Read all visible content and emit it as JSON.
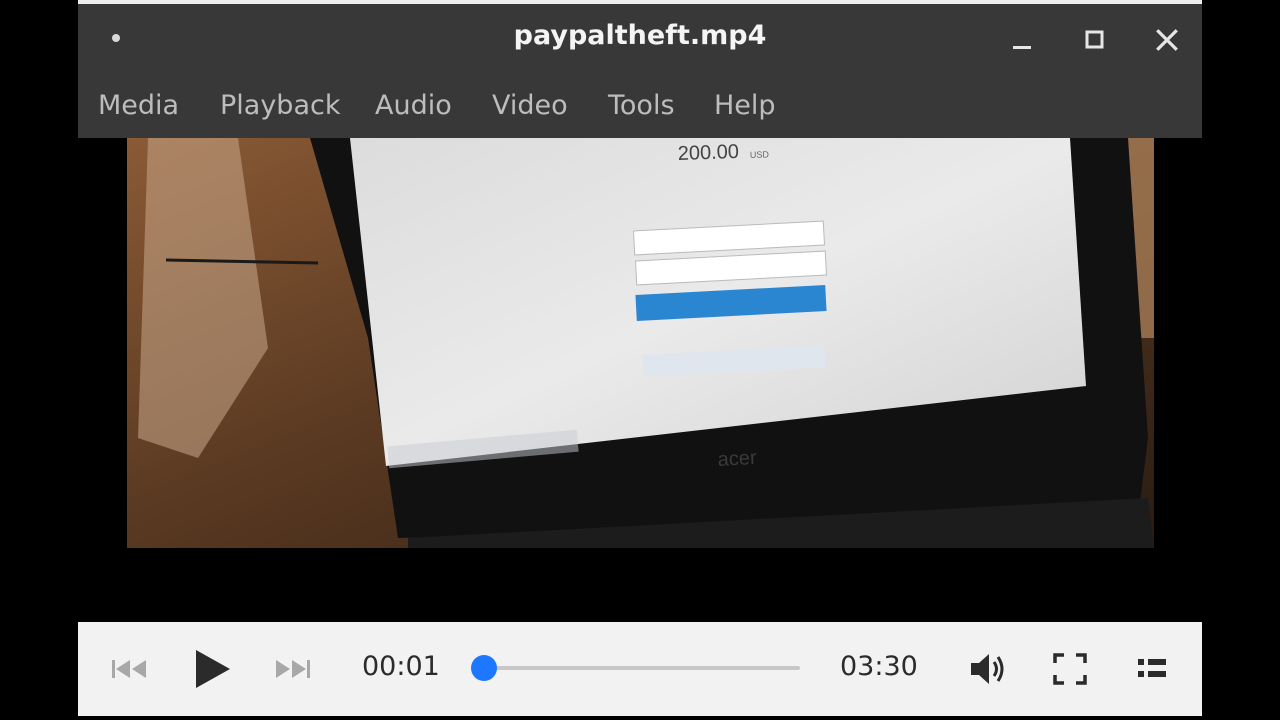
{
  "window": {
    "title": "paypaltheft.mp4"
  },
  "menu": {
    "items": [
      "Media",
      "Playback",
      "Audio",
      "Video",
      "Tools",
      "Help"
    ]
  },
  "player": {
    "current_time": "00:01",
    "total_time": "03:30",
    "progress": 0.005,
    "accent_color": "#1e78ff"
  },
  "icons": {
    "window": [
      "menu-dot-icon",
      "minimize-icon",
      "maximize-icon",
      "close-icon"
    ],
    "controls": [
      "previous-icon",
      "play-icon",
      "next-icon",
      "volume-icon",
      "fullscreen-icon",
      "playlist-icon"
    ]
  },
  "video_frame": {
    "amount": "200.00",
    "currency": "USD",
    "laptop_brand": "acer"
  }
}
